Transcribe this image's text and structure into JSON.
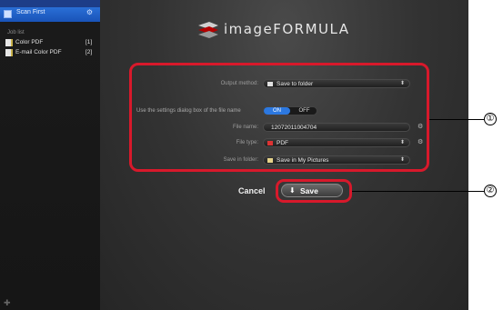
{
  "sidebar": {
    "header_label": "Scan First",
    "job_list_label": "Job list",
    "items": [
      {
        "label": "Color PDF",
        "number": "[1]"
      },
      {
        "label": "E-mail Color PDF",
        "number": "[2]"
      }
    ]
  },
  "logo": {
    "text": "imageFORMULA"
  },
  "form": {
    "output_method_label": "Output method:",
    "output_method_value": "Save to folder",
    "settings_dialog_label": "Use the settings dialog box of the file name",
    "toggle_on": "ON",
    "toggle_off": "OFF",
    "file_name_label": "File name:",
    "file_name_value": "12072011004704",
    "file_type_label": "File type:",
    "file_type_value": "PDF",
    "save_in_folder_label": "Save in folder:",
    "save_in_folder_value": "Save in My Pictures"
  },
  "actions": {
    "cancel_label": "Cancel",
    "save_label": "Save"
  },
  "callouts": {
    "one": "①",
    "two": "②"
  },
  "colors": {
    "callout": "#d8192b",
    "toggle_on": "#2c78e0"
  }
}
